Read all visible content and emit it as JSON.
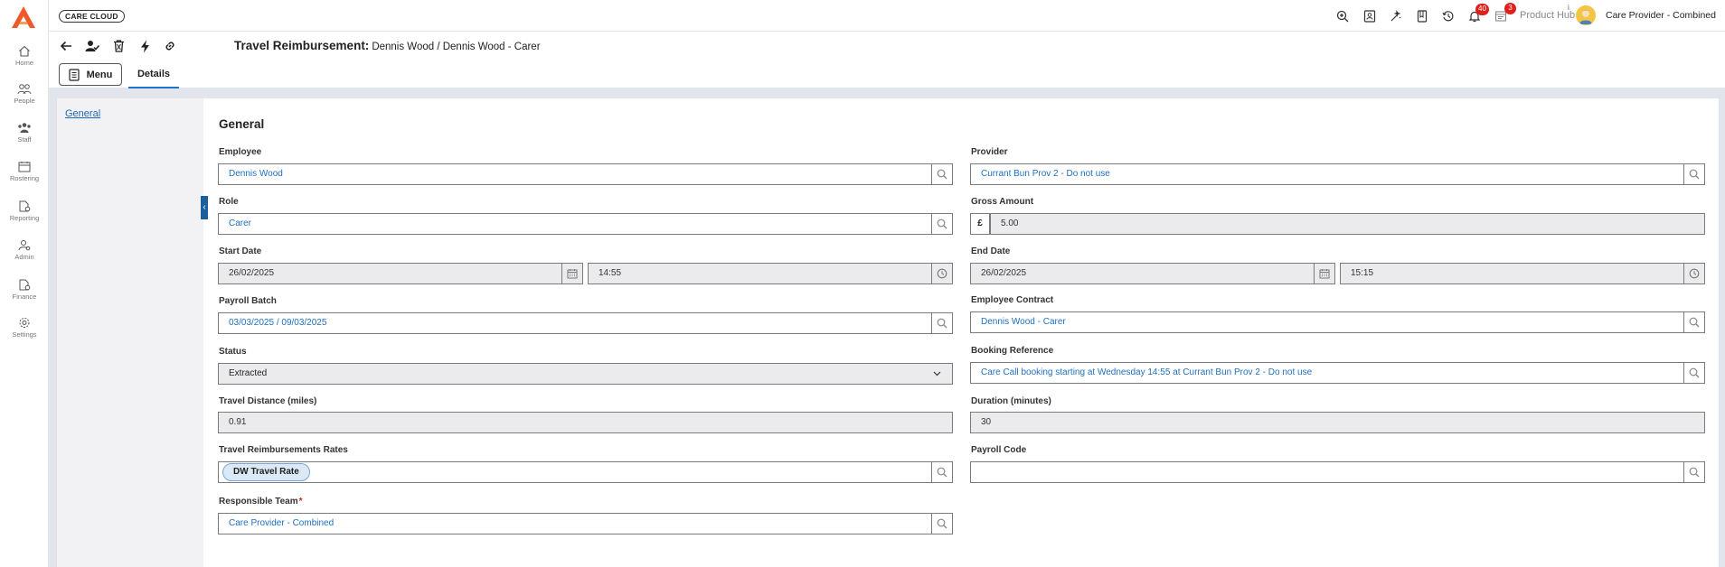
{
  "app": {
    "brand": "CARE CLOUD",
    "product_hub": "Product Hub",
    "info_mark": "i",
    "user": "Care Provider - Combined",
    "notifications_count": "40",
    "product_hub_count": "3"
  },
  "nav": {
    "items": [
      {
        "label": "Home",
        "icon": "home-icon"
      },
      {
        "label": "People",
        "icon": "people-icon"
      },
      {
        "label": "Staff",
        "icon": "staff-icon"
      },
      {
        "label": "Rostering",
        "icon": "rostering-icon"
      },
      {
        "label": "Reporting",
        "icon": "reporting-icon"
      },
      {
        "label": "Admin",
        "icon": "admin-icon"
      },
      {
        "label": "Finance",
        "icon": "finance-icon"
      },
      {
        "label": "Settings",
        "icon": "settings-icon"
      }
    ]
  },
  "title": {
    "strong": "Travel Reimbursement:",
    "rest": "Dennis Wood / Dennis Wood - Carer"
  },
  "tabs": {
    "menu": "Menu",
    "details": "Details"
  },
  "side": {
    "general_link": "General"
  },
  "form": {
    "section": "General",
    "employee": {
      "label": "Employee",
      "value": "Dennis Wood"
    },
    "provider": {
      "label": "Provider",
      "value": "Currant Bun Prov 2 - Do not use"
    },
    "role": {
      "label": "Role",
      "value": "Carer"
    },
    "gross_amount": {
      "label": "Gross Amount",
      "currency": "£",
      "value": "5.00"
    },
    "start_date": {
      "label": "Start Date",
      "date": "26/02/2025",
      "time": "14:55"
    },
    "end_date": {
      "label": "End Date",
      "date": "26/02/2025",
      "time": "15:15"
    },
    "payroll_batch": {
      "label": "Payroll Batch",
      "value": "03/03/2025 / 09/03/2025"
    },
    "employee_contract": {
      "label": "Employee Contract",
      "value": "Dennis Wood - Carer"
    },
    "status": {
      "label": "Status",
      "value": "Extracted"
    },
    "booking_reference": {
      "label": "Booking Reference",
      "value": "Care Call booking starting at Wednesday 14:55 at Currant Bun Prov 2 - Do not use"
    },
    "travel_distance": {
      "label": "Travel Distance (miles)",
      "value": "0.91"
    },
    "duration": {
      "label": "Duration (minutes)",
      "value": "30"
    },
    "rates": {
      "label": "Travel Reimbursements Rates",
      "chip": "DW Travel Rate"
    },
    "payroll_code": {
      "label": "Payroll Code",
      "value": ""
    },
    "responsible_team": {
      "label": "Responsible Team",
      "required_mark": "*",
      "value": "Care Provider - Combined"
    }
  },
  "colors": {
    "accent": "#1f74c7",
    "link": "#1f66b8",
    "badge": "#e0201a",
    "logo": "#f0592a"
  }
}
